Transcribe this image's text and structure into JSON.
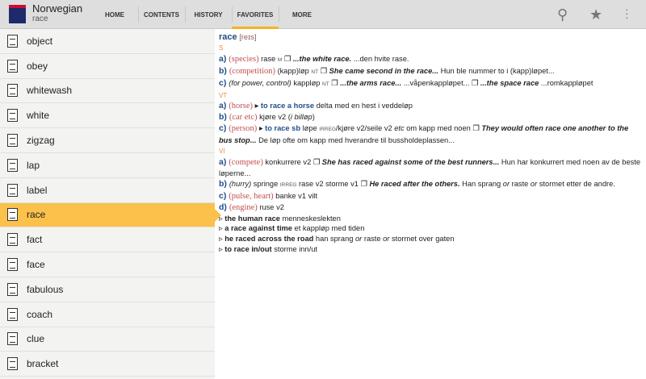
{
  "header": {
    "title": "Norwegian",
    "subtitle": "race",
    "tabs": [
      "HOME",
      "CONTENTS",
      "HISTORY",
      "FAVORITES",
      "MORE"
    ],
    "active_tab": 3
  },
  "sidebar": {
    "items": [
      "object",
      "obey",
      "whitewash",
      "white",
      "zigzag",
      "lap",
      "label",
      "race",
      "fact",
      "face",
      "fabulous",
      "coach",
      "clue",
      "bracket"
    ],
    "selected": 7
  },
  "entry": {
    "lines": [
      [
        [
          "race",
          "hw"
        ],
        [
          " [reɪs]",
          "pr"
        ]
      ],
      [
        [
          "S",
          "pos"
        ]
      ],
      [
        [
          "a) ",
          "lbl"
        ],
        [
          "(species)",
          "ctx"
        ],
        [
          " rase ",
          ""
        ],
        [
          "M",
          "sc"
        ],
        [
          " ❐ ",
          ""
        ],
        [
          "...the white race.",
          "bi"
        ],
        [
          " ...den hvite rase.",
          ""
        ]
      ],
      [
        [
          "b) ",
          "lbl"
        ],
        [
          "(competition)",
          "ctx"
        ],
        [
          " (kapp)løp ",
          ""
        ],
        [
          "NT",
          "sc"
        ],
        [
          " ❐ ",
          ""
        ],
        [
          "She came second in the race...",
          "bi"
        ],
        [
          " Hun ble nummer to i (kapp)løpet...",
          ""
        ]
      ],
      [
        [
          "c) ",
          "lbl"
        ],
        [
          "(for power, control)",
          "it"
        ],
        [
          " kappløp ",
          ""
        ],
        [
          "NT",
          "sc"
        ],
        [
          " ❐ ",
          ""
        ],
        [
          "...the arms race...",
          "bi"
        ],
        [
          " ...våpenkappløpet... ❐ ",
          ""
        ],
        [
          "...the space race",
          "bi"
        ],
        [
          " ...romkappløpet",
          ""
        ]
      ],
      [
        [
          "VT",
          "pos"
        ]
      ],
      [
        [
          "a) ",
          "lbl"
        ],
        [
          "(horse)",
          "ctx"
        ],
        [
          " ▸ ",
          ""
        ],
        [
          "to race a horse",
          "phr"
        ],
        [
          " delta med en hest i veddeløp",
          ""
        ]
      ],
      [
        [
          "b) ",
          "lbl"
        ],
        [
          "(car etc)",
          "ctx"
        ],
        [
          " kjøre v2 (",
          ""
        ],
        [
          "i billøp",
          "it"
        ],
        [
          ")",
          ""
        ]
      ],
      [
        [
          "c) ",
          "lbl"
        ],
        [
          "(person)",
          "ctx"
        ],
        [
          " ▸ ",
          ""
        ],
        [
          "to race sb",
          "phr"
        ],
        [
          " løpe ",
          ""
        ],
        [
          "IRREG",
          "sc"
        ],
        [
          "/kjøre v2/seile v2 ",
          ""
        ],
        [
          "etc",
          "it"
        ],
        [
          " om kapp med noen ❐ ",
          ""
        ],
        [
          "They would often race one another to the bus stop...",
          "bi"
        ],
        [
          " De løp ofte om kapp med hverandre til bussholdeplassen...",
          ""
        ]
      ],
      [
        [
          "VI",
          "pos"
        ]
      ],
      [
        [
          "a) ",
          "lbl"
        ],
        [
          "(compete)",
          "ctx"
        ],
        [
          " konkurrere v2 ❐ ",
          ""
        ],
        [
          "She has raced against some of the best runners...",
          "bi"
        ],
        [
          " Hun har konkurrert med noen av de beste løperne...",
          ""
        ]
      ],
      [
        [
          "b) ",
          "lbl"
        ],
        [
          "(hurry)",
          "it"
        ],
        [
          " springe ",
          ""
        ],
        [
          "IRREG",
          "sc"
        ],
        [
          " rase v2 storme v1 ❐ ",
          ""
        ],
        [
          "He raced after the others.",
          "bi"
        ],
        [
          " Han sprang ",
          ""
        ],
        [
          "or",
          "it"
        ],
        [
          " raste ",
          ""
        ],
        [
          "or",
          "it"
        ],
        [
          " stormet etter de andre.",
          ""
        ]
      ],
      [
        [
          "c) ",
          "lbl"
        ],
        [
          "(pulse, heart)",
          "ctx"
        ],
        [
          " banke v1 vilt",
          ""
        ]
      ],
      [
        [
          "d) ",
          "lbl"
        ],
        [
          "(engine)",
          "ctx"
        ],
        [
          " ruse v2",
          ""
        ]
      ],
      [
        [
          "▹ ",
          ""
        ],
        [
          "the human race",
          "b"
        ],
        [
          " menneskeslekten",
          ""
        ]
      ],
      [
        [
          "▹ ",
          ""
        ],
        [
          "a race against time",
          "b"
        ],
        [
          " et kappløp med tiden",
          ""
        ]
      ],
      [
        [
          "▹ ",
          ""
        ],
        [
          "he raced across the road",
          "b"
        ],
        [
          " han sprang ",
          ""
        ],
        [
          "or",
          "it"
        ],
        [
          " raste ",
          ""
        ],
        [
          "or",
          "it"
        ],
        [
          " stormet over gaten",
          ""
        ]
      ],
      [
        [
          "▹ ",
          ""
        ],
        [
          "to race in/out",
          "b"
        ],
        [
          " storme inn/ut",
          ""
        ]
      ]
    ]
  }
}
